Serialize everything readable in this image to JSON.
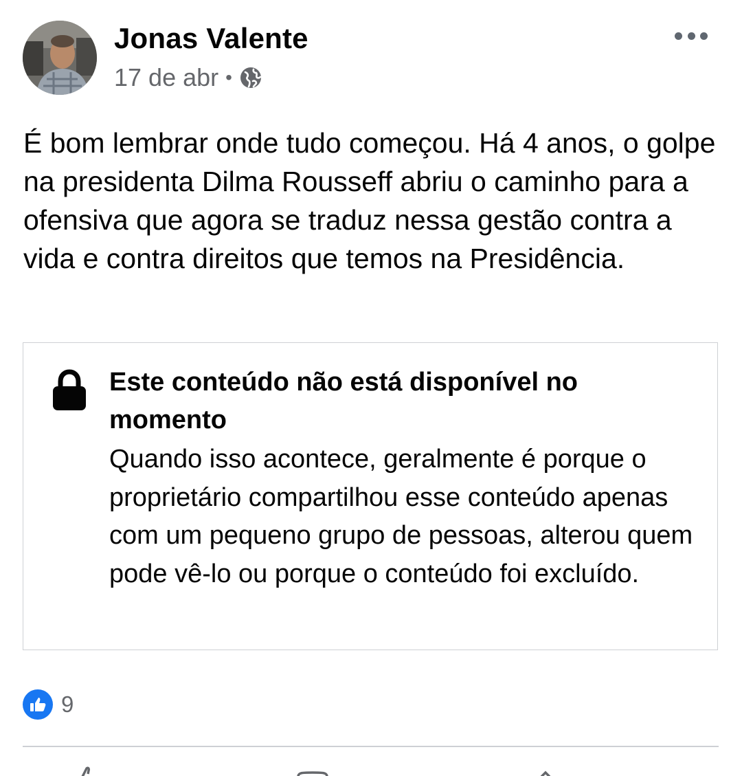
{
  "post": {
    "author": "Jonas Valente",
    "date": "17 de abr",
    "separator": "•",
    "privacy_icon": "globe-icon",
    "menu_icon": "more-horizontal-icon",
    "text": "É bom lembrar onde tudo começou. Há 4 anos, o golpe na presidenta Dilma Rousseff abriu o caminho para a ofensiva que agora se traduz nessa gestão contra a vida e contra direitos que temos na Presidência."
  },
  "attachment": {
    "icon": "lock-icon",
    "title": "Este conteúdo não está disponível no momento",
    "body": "Quando isso acontece, geralmente é porque o proprietário compartilhou esse conteúdo apenas com um pequeno grupo de pessoas, alterou quem pode vê-lo ou porque o conteúdo foi excluído."
  },
  "reactions": {
    "icon": "like-icon",
    "count": "9"
  },
  "colors": {
    "text": "#050505",
    "secondary": "#65676b",
    "like_blue": "#1877f2",
    "border": "#ced0d4"
  }
}
